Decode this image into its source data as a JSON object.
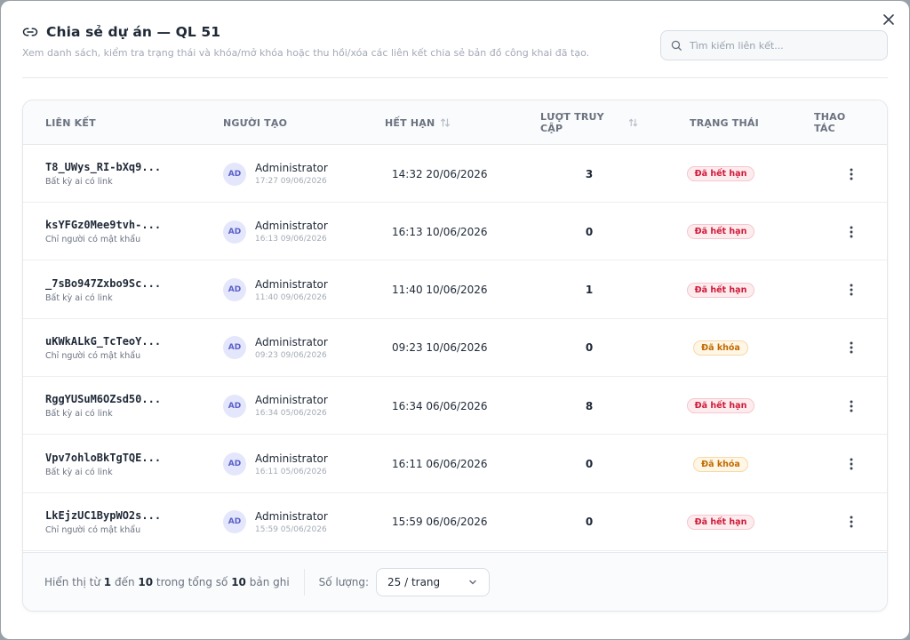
{
  "modal": {
    "title": "Chia sẻ dự án — QL 51",
    "subtitle": "Xem danh sách, kiểm tra trạng thái và khóa/mở khóa hoặc thu hồi/xóa các liên kết chia sẻ bản đồ công khai đã tạo.",
    "icons": {
      "title": "link-icon",
      "close": "close-icon",
      "search": "search-icon"
    }
  },
  "search": {
    "placeholder": "Tìm kiếm liên kết..."
  },
  "table": {
    "headers": {
      "link": "LIÊN KẾT",
      "creator": "NGƯỜI TẠO",
      "expires": "HẾT HẠN",
      "hits": "LƯỢT TRUY CẬP",
      "status": "TRẠNG THÁI",
      "actions": "THAO TÁC"
    },
    "rows": [
      {
        "code": "T8_UWys_RI-bXq9...",
        "access": "Bất kỳ ai có link",
        "avatar": "AD",
        "creator": "Administrator",
        "created": "17:27 09/06/2026",
        "expires": "14:32 20/06/2026",
        "hits": "3",
        "status": "Đã hết hạn",
        "status_kind": "expired"
      },
      {
        "code": "ksYFGz0Mee9tvh-...",
        "access": "Chỉ người có mật khẩu",
        "avatar": "AD",
        "creator": "Administrator",
        "created": "16:13 09/06/2026",
        "expires": "16:13 10/06/2026",
        "hits": "0",
        "status": "Đã hết hạn",
        "status_kind": "expired"
      },
      {
        "code": "_7sBo947Zxbo9Sc...",
        "access": "Bất kỳ ai có link",
        "avatar": "AD",
        "creator": "Administrator",
        "created": "11:40 09/06/2026",
        "expires": "11:40 10/06/2026",
        "hits": "1",
        "status": "Đã hết hạn",
        "status_kind": "expired"
      },
      {
        "code": "uKWkALkG_TcTeoY...",
        "access": "Chỉ người có mật khẩu",
        "avatar": "AD",
        "creator": "Administrator",
        "created": "09:23 09/06/2026",
        "expires": "09:23 10/06/2026",
        "hits": "0",
        "status": "Đã khóa",
        "status_kind": "locked"
      },
      {
        "code": "RggYUSuM6OZsd50...",
        "access": "Bất kỳ ai có link",
        "avatar": "AD",
        "creator": "Administrator",
        "created": "16:34 05/06/2026",
        "expires": "16:34 06/06/2026",
        "hits": "8",
        "status": "Đã hết hạn",
        "status_kind": "expired"
      },
      {
        "code": "Vpv7ohloBkTgTQE...",
        "access": "Bất kỳ ai có link",
        "avatar": "AD",
        "creator": "Administrator",
        "created": "16:11 05/06/2026",
        "expires": "16:11 06/06/2026",
        "hits": "0",
        "status": "Đã khóa",
        "status_kind": "locked"
      },
      {
        "code": "LkEjzUC1BypWO2s...",
        "access": "Chỉ người có mật khẩu",
        "avatar": "AD",
        "creator": "Administrator",
        "created": "15:59 05/06/2026",
        "expires": "15:59 06/06/2026",
        "hits": "0",
        "status": "Đã hết hạn",
        "status_kind": "expired"
      }
    ]
  },
  "footer": {
    "prefix": "Hiển thị từ",
    "from": "1",
    "to_word": "đến",
    "to": "10",
    "total_word": "trong tổng số",
    "total": "10",
    "suffix": "bản ghi",
    "page_size_label": "Số lượng:",
    "page_size_value": "25 / trang"
  },
  "colors": {
    "expired_text": "#d11a3a",
    "locked_text": "#c26a00",
    "avatar_text": "#5a5fc9"
  }
}
